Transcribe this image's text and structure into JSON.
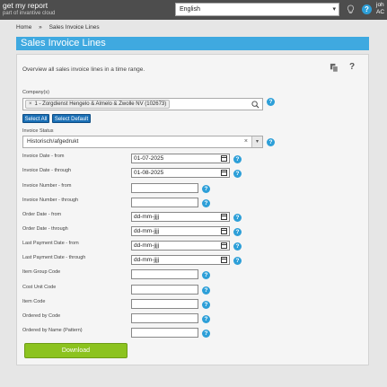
{
  "brand": {
    "title": "get my report",
    "subtitle": "part of invantive cloud"
  },
  "header": {
    "language": "English",
    "user_short": "joh\nAC"
  },
  "breadcrumb": {
    "home": "Home",
    "separator": "»",
    "current": "Sales Invoice Lines"
  },
  "page": {
    "title": "Sales Invoice Lines",
    "overview": "Overview all sales invoice lines in a time range."
  },
  "form": {
    "company_label": "Company(s)",
    "company_chip": "1 - Zorgdienst Hengelo & Almelo & Zwolle NV (102673)",
    "select_all": "Select All",
    "select_default": "Select Default",
    "invoice_status_label": "Invoice Status",
    "invoice_status_value": "Historisch/afgedrukt",
    "fields": [
      {
        "label": "Invoice Date - from",
        "value": "01-07-2025",
        "type": "date"
      },
      {
        "label": "Invoice Date - through",
        "value": "01-08-2025",
        "type": "date"
      },
      {
        "label": "Invoice Number - from",
        "value": "",
        "type": "text"
      },
      {
        "label": "Invoice Number - through",
        "value": "",
        "type": "text"
      },
      {
        "label": "Order Date - from",
        "value": "dd-mm-jjjj",
        "type": "date"
      },
      {
        "label": "Order Date - through",
        "value": "dd-mm-jjjj",
        "type": "date"
      },
      {
        "label": "Last Payment Date - from",
        "value": "dd-mm-jjjj",
        "type": "date"
      },
      {
        "label": "Last Payment Date - through",
        "value": "dd-mm-jjjj",
        "type": "date"
      },
      {
        "label": "Item Group Code",
        "value": "",
        "type": "text"
      },
      {
        "label": "Cost Unit Code",
        "value": "",
        "type": "text"
      },
      {
        "label": "Item Code",
        "value": "",
        "type": "text"
      },
      {
        "label": "Ordered by Code",
        "value": "",
        "type": "text"
      },
      {
        "label": "Ordered by Name (Pattern)",
        "value": "",
        "type": "text"
      }
    ],
    "download": "Download"
  },
  "colors": {
    "accent": "#3fa9e0",
    "topbar": "#4d4d4d",
    "download": "#8cc31f",
    "button": "#1a6fb5"
  },
  "icons": [
    "lightbulb-icon",
    "help-icon",
    "copy-icon",
    "question-icon",
    "search-icon",
    "calendar-icon",
    "info-icon"
  ]
}
